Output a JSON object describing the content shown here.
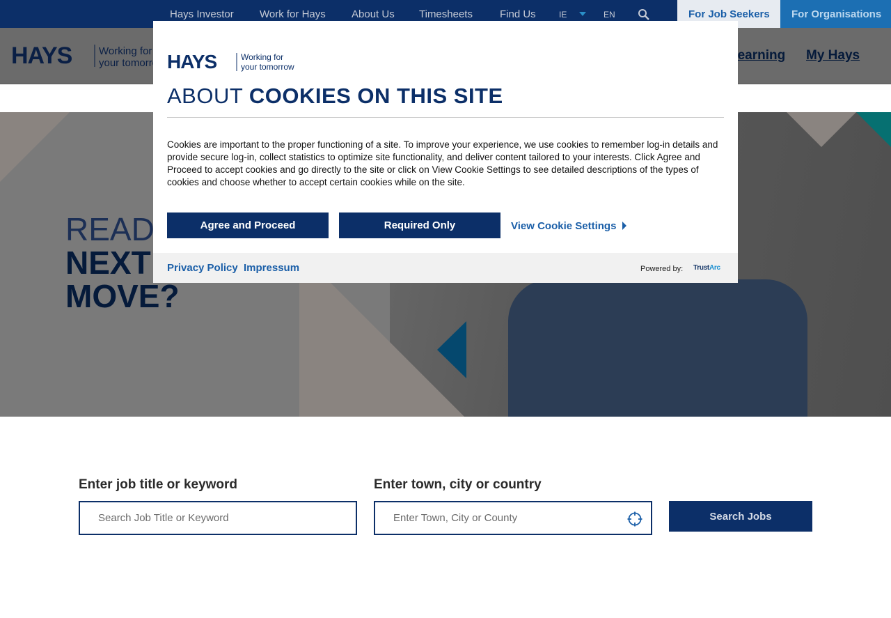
{
  "topbar": {
    "links": [
      "Hays Investor",
      "Work for Hays",
      "About Us",
      "Timesheets",
      "Find Us"
    ],
    "country": "IE",
    "language": "EN",
    "search_icon": "search-icon",
    "tab_seekers": "For Job Seekers",
    "tab_orgs": "For Organisations"
  },
  "header": {
    "logo_text": "HAYS",
    "tagline_1": "Working for",
    "tagline_2": "your tomorrow",
    "nav_learning": "Learning",
    "nav_myhays": "My Hays"
  },
  "hero": {
    "line1": "READY",
    "line2": "NEXT",
    "line3": "MOVE?"
  },
  "search": {
    "keyword_label": "Enter job title or keyword",
    "keyword_placeholder": "Search Job Title or Keyword",
    "location_label": "Enter town, city or country",
    "location_placeholder": "Enter Town, City or County",
    "location_icon": "locate-crosshair-icon",
    "button": "Search Jobs"
  },
  "cookie_dialog": {
    "logo_text": "HAYS",
    "logo_tag_1": "Working for",
    "logo_tag_2": "your tomorrow",
    "title_light": "ABOUT ",
    "title_bold": "COOKIES ON THIS SITE",
    "body": "Cookies are important to the proper functioning of a site. To improve your experience, we use cookies to remember log-in details and provide secure log-in, collect statistics to optimize site functionality, and deliver content tailored to your interests. Click Agree and Proceed to accept cookies and go directly to the site or click on View Cookie Settings to see detailed descriptions of the types of cookies and choose whether to accept certain cookies while on the site.",
    "agree_button": "Agree and Proceed",
    "required_button": "Required Only",
    "view_settings": "View Cookie Settings",
    "privacy_link": "Privacy Policy",
    "impressum_link": "Impressum",
    "powered_by": "Powered by:",
    "trustarc_a": "Trust",
    "trustarc_b": "Arc"
  },
  "colors": {
    "navy": "#0c2f68",
    "accent_blue": "#1b5fa8",
    "teal": "#067071"
  }
}
